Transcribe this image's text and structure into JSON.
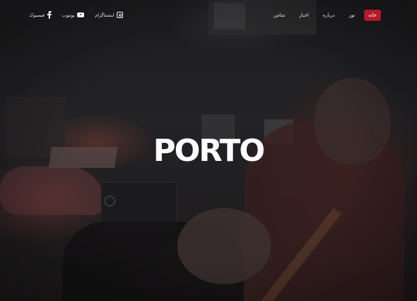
{
  "nav": {
    "items": [
      {
        "label": "خانه",
        "active": true
      },
      {
        "label": "تور",
        "active": false
      },
      {
        "label": "درباره",
        "active": false
      },
      {
        "label": "اخبار",
        "active": false
      },
      {
        "label": "تماس",
        "active": false
      }
    ]
  },
  "social": {
    "instagram": {
      "label": "اینستاگرام",
      "icon": "instagram-icon"
    },
    "youtube": {
      "label": "یوتیوب",
      "icon": "youtube-icon"
    },
    "facebook": {
      "label": "فیسبوک",
      "icon": "facebook-icon"
    }
  },
  "hero": {
    "logo_text": "PORTO"
  },
  "colors": {
    "accent": "#b61a2a",
    "background": "#1d1d1f",
    "text": "#ffffff"
  }
}
